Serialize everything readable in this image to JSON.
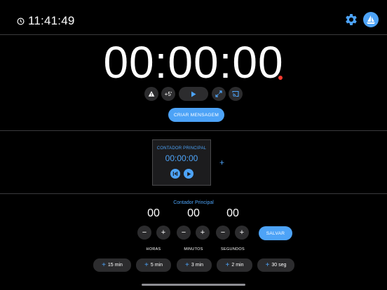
{
  "status": {
    "time": "11:41:49"
  },
  "main": {
    "timer": "00:00:00",
    "controls": {
      "plus5_label": "+5'"
    },
    "create_message_label": "CRIAR MENSAGEM"
  },
  "timers": {
    "card": {
      "title": "CONTADOR PRINCIPAL",
      "time": "00:00:00"
    },
    "add_label": "+"
  },
  "editor": {
    "title": "Contador Principal",
    "hours": "00",
    "minutes": "00",
    "seconds": "00",
    "hours_label": "HORAS",
    "minutes_label": "MINUTOS",
    "seconds_label": "SEGUNDOS",
    "minus_glyph": "−",
    "plus_glyph": "+",
    "save_label": "SALVAR",
    "quick_add": [
      "15 min",
      "5 min",
      "3 min",
      "2 min",
      "30 seg"
    ]
  },
  "colors": {
    "accent": "#4da3f7",
    "recording": "#ff3b30",
    "surface": "#2c2c2e"
  }
}
